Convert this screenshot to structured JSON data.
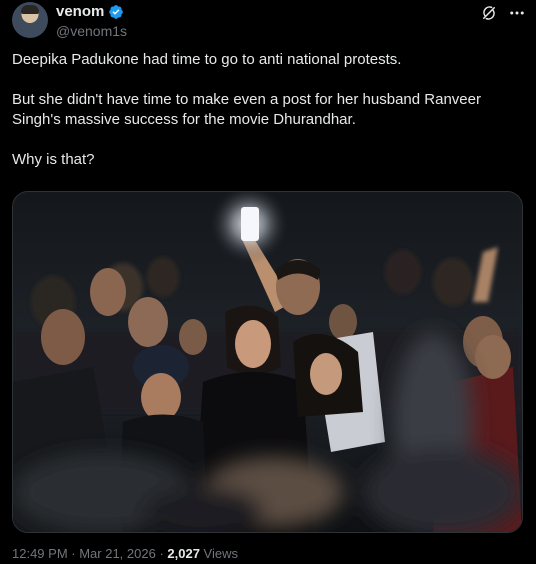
{
  "author": {
    "name": "venom",
    "handle": "@venom1s",
    "verified_color": "#1d9bf0"
  },
  "tweet": {
    "paragraphs": [
      "Deepika Padukone had time to go to anti national protests.",
      "But she didn't have time to make even a post for her husband Ranveer Singh's massive success for the movie Dhurandhar.",
      "Why is that?"
    ]
  },
  "icons": {
    "grok": "grok-icon",
    "more": "more-icon",
    "verified": "verified-badge-icon"
  },
  "meta": {
    "time": "12:49 PM",
    "sep1": " · ",
    "date": "Mar 21, 2026",
    "sep2": " · ",
    "views_count": "2,027",
    "views_label": " Views"
  },
  "colors": {
    "background": "#000000",
    "text": "#e7e9ea",
    "secondary": "#71767b",
    "border": "#2f3336"
  }
}
